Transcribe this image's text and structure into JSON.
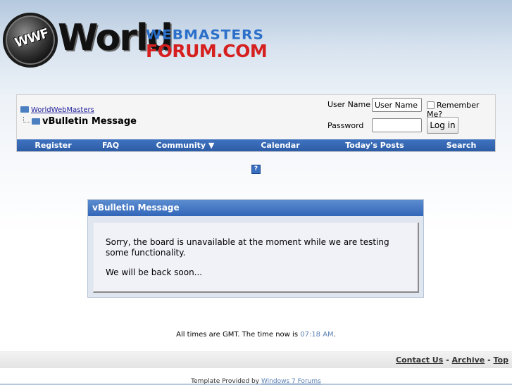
{
  "logo": {
    "globe_text": "WWF",
    "world_text": "World",
    "webmasters_text": "WEBMASTERS",
    "forum_text": "FORUM.COM"
  },
  "breadcrumb": {
    "home_link": "WorldWebMasters",
    "current": "vBulletin Message"
  },
  "login": {
    "username_label": "User Name",
    "username_value": "User Name",
    "password_label": "Password",
    "password_value": "",
    "remember_label": "Remember Me?",
    "button_label": "Log in"
  },
  "navbar": {
    "register": "Register",
    "faq": "FAQ",
    "community": "Community",
    "calendar": "Calendar",
    "todays_posts": "Today's Posts",
    "search": "Search"
  },
  "help_icon_text": "?",
  "message": {
    "title": "vBulletin Message",
    "line1": "Sorry, the board is unavailable at the moment while we are testing some functionality.",
    "line2": "We will be back soon..."
  },
  "footer": {
    "time_prefix": "All times are GMT. The time now is",
    "time_value": "07:18 AM",
    "time_suffix": ".",
    "contact": "Contact Us",
    "archive": "Archive",
    "top": "Top",
    "separator": "-",
    "credit_prefix": "Template Provided by",
    "credit_link": "Windows 7 Forums"
  },
  "colors": {
    "navbar": "#3468b6",
    "message_header": "#4a7cc6",
    "link": "#22229c"
  }
}
